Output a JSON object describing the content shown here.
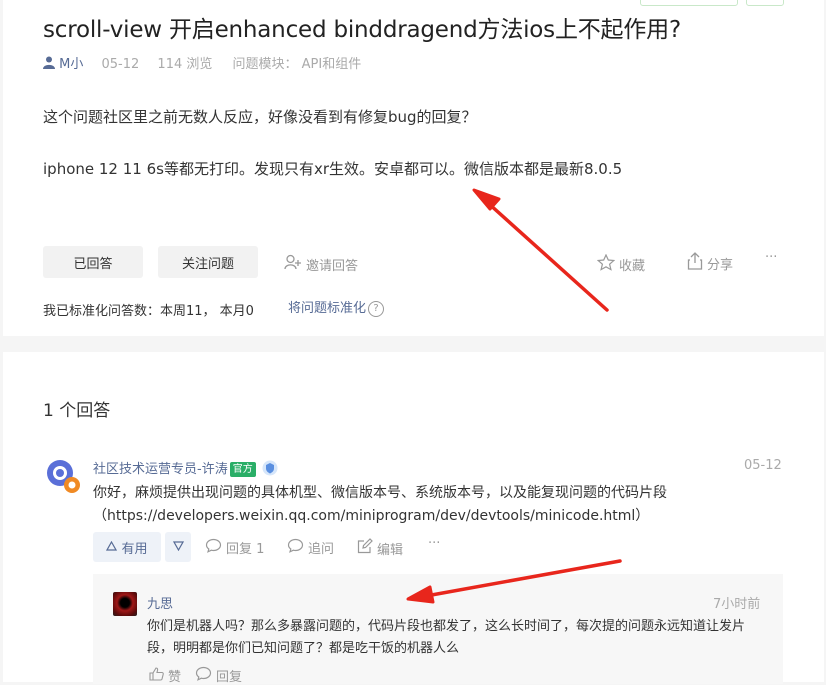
{
  "question": {
    "title": "scroll-view 开启enhanced binddragend方法ios上不起作用?",
    "author": "M小",
    "date": "05-12",
    "views": "114 浏览",
    "module": "问题模块： API和组件",
    "body_line1": "这个问题社区里之前无数人反应，好像没看到有修复bug的回复？",
    "body_line2": "iphone 12 11 6s等都无打印。发现只有xr生效。安卓都可以。微信版本都是最新8.0.5",
    "buttons": {
      "answered": "已回答",
      "follow": "关注问题",
      "invite": "邀请回答"
    },
    "actions": {
      "collect": "收藏",
      "share": "分享",
      "more": "···"
    },
    "stats": "我已标准化问答数：本周11， 本月0",
    "standardize_link": "将问题标准化",
    "help_mark": "?"
  },
  "answers": {
    "count_label": "1 个回答",
    "items": [
      {
        "author": "社区技术运营专员-许涛",
        "badge": "官方",
        "date": "05-12",
        "text": "你好，麻烦提供出现问题的具体机型、微信版本号、系统版本号，以及能复现问题的代码片段（https://developers.weixin.qq.com/miniprogram/dev/devtools/minicode.html）",
        "useful": "有用",
        "reply": "回复 1",
        "ask": "追问",
        "edit": "编辑",
        "more": "···",
        "replies": [
          {
            "author": "九思",
            "time": "7小时前",
            "text": "你们是机器人吗？那么多暴露问题的，代码片段也都发了，这么长时间了，每次提的问题永远知道让发片段，明明都是你们已知问题了？都是吃干饭的机器人么",
            "like": "赞",
            "reply": "回复"
          }
        ]
      }
    ]
  },
  "colors": {
    "link": "#576b95",
    "official": "#2aae67",
    "arrow": "#e8261c"
  }
}
